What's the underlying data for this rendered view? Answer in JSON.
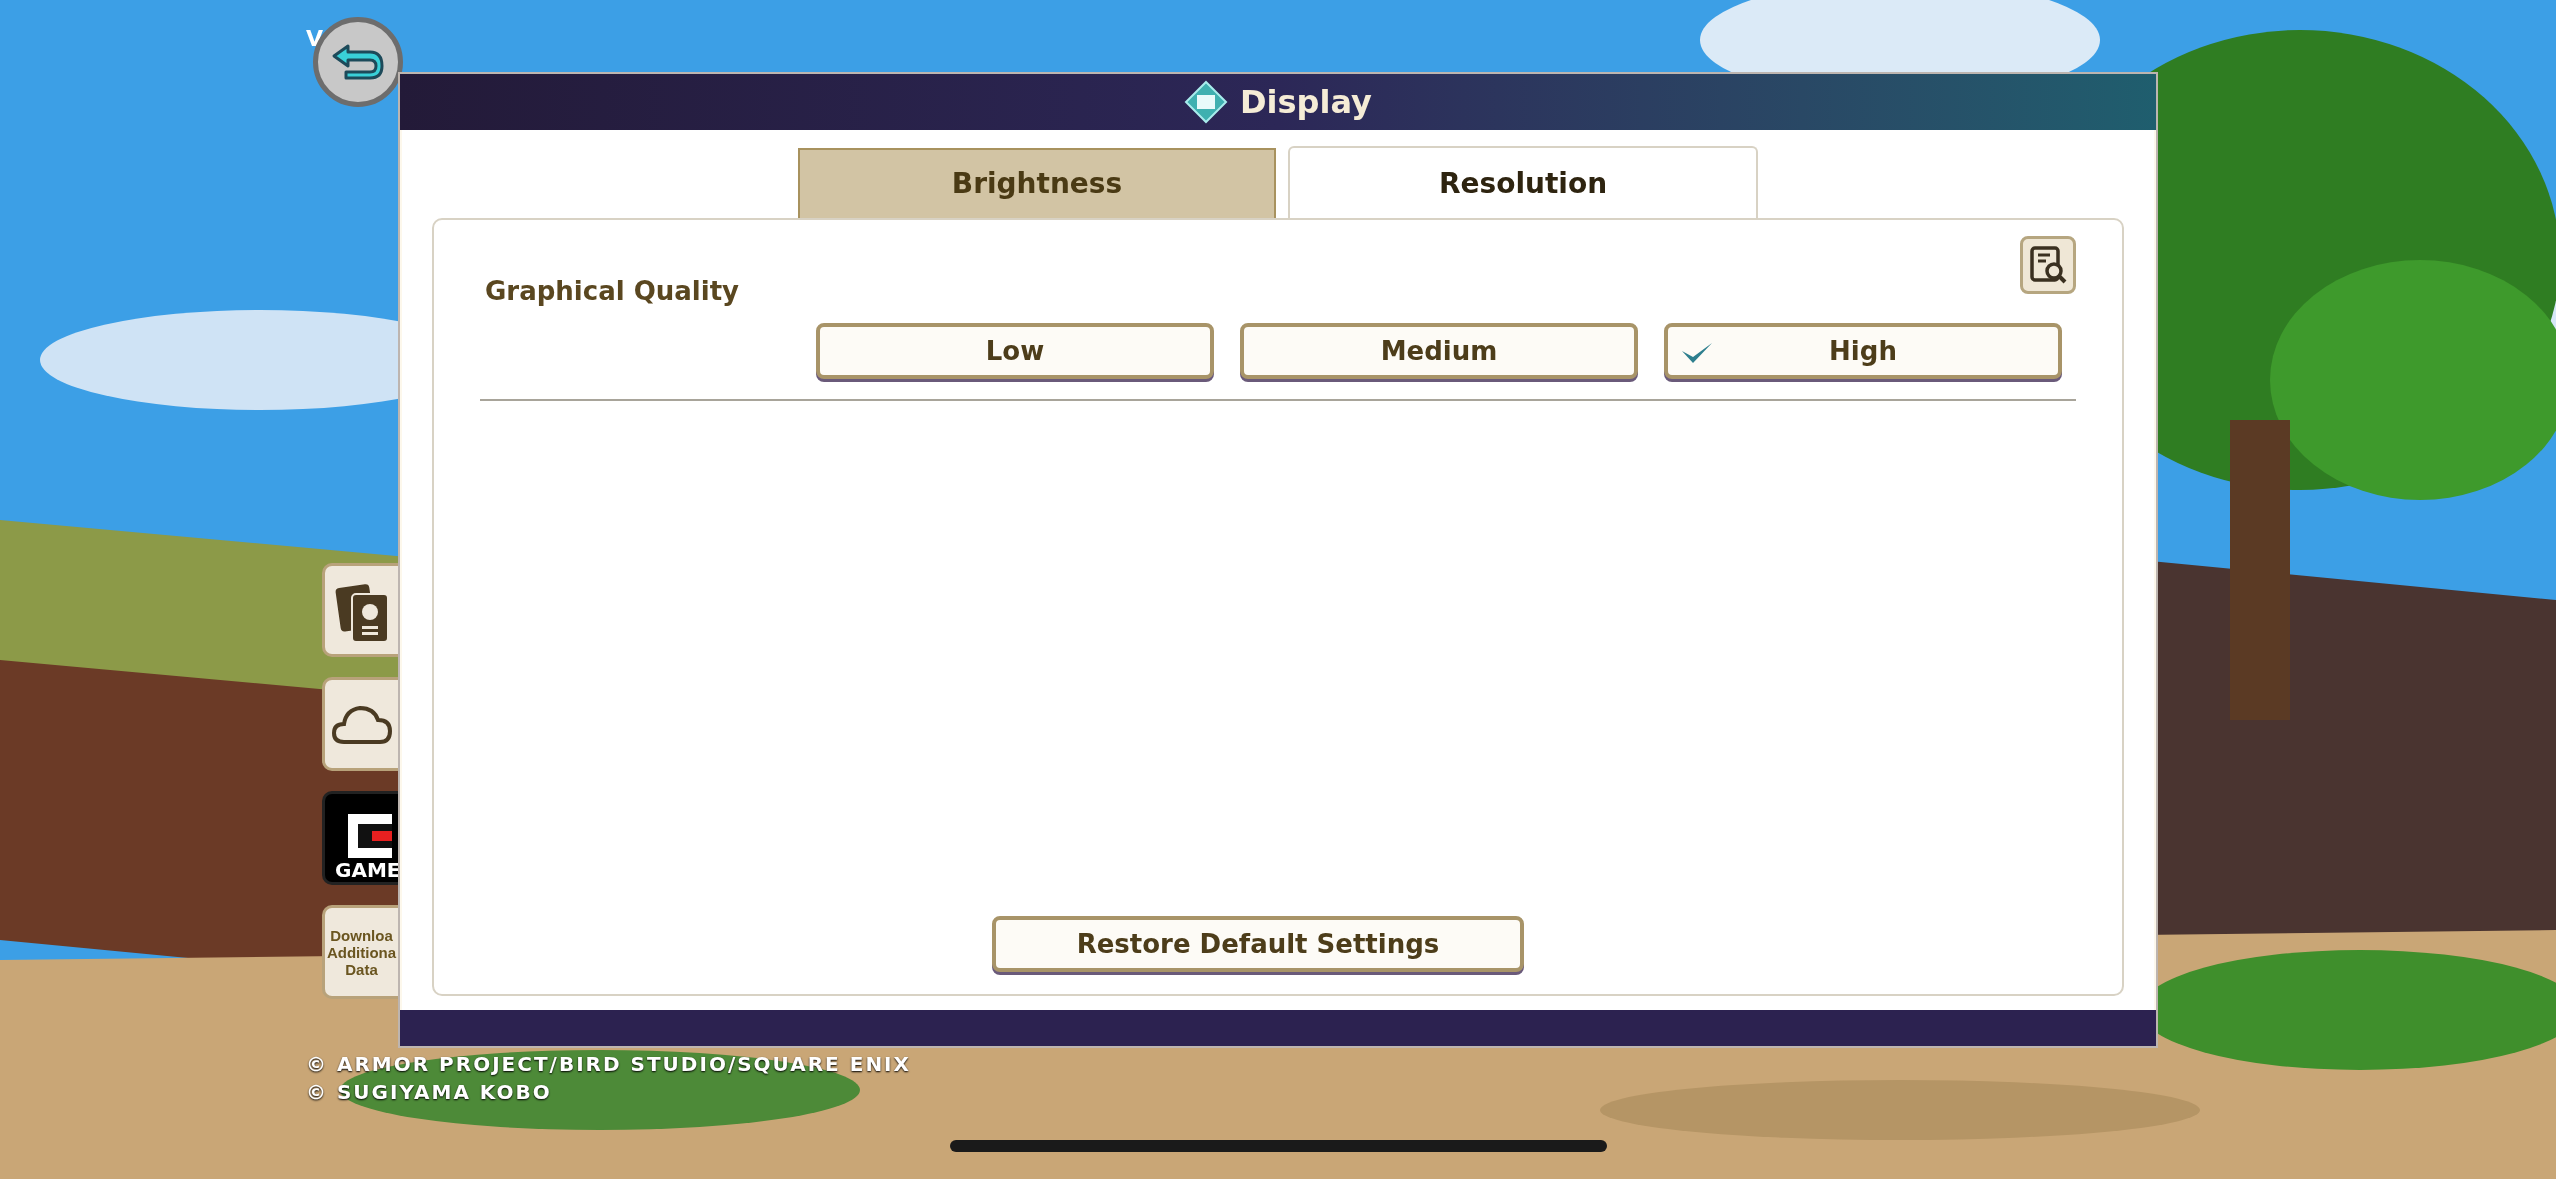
{
  "corner_text": "V",
  "side_buttons": [
    {
      "kind": "cards"
    },
    {
      "kind": "cloud"
    },
    {
      "kind": "logo",
      "label": "GAME"
    },
    {
      "kind": "text",
      "label": "Downloa\nAdditiona\nData"
    }
  ],
  "dialog": {
    "title": "Display",
    "tabs": [
      {
        "label": "Brightness",
        "selected": false
      },
      {
        "label": "Resolution",
        "selected": true
      }
    ],
    "setting": {
      "label": "Graphical Quality",
      "options": [
        {
          "label": "Low",
          "selected": false
        },
        {
          "label": "Medium",
          "selected": false
        },
        {
          "label": "High",
          "selected": true
        }
      ]
    },
    "restore_button": "Restore Default Settings"
  },
  "copyright": [
    "© ARMOR PROJECT/BIRD STUDIO/SQUARE ENIX",
    "© SUGIYAMA KOBO"
  ]
}
